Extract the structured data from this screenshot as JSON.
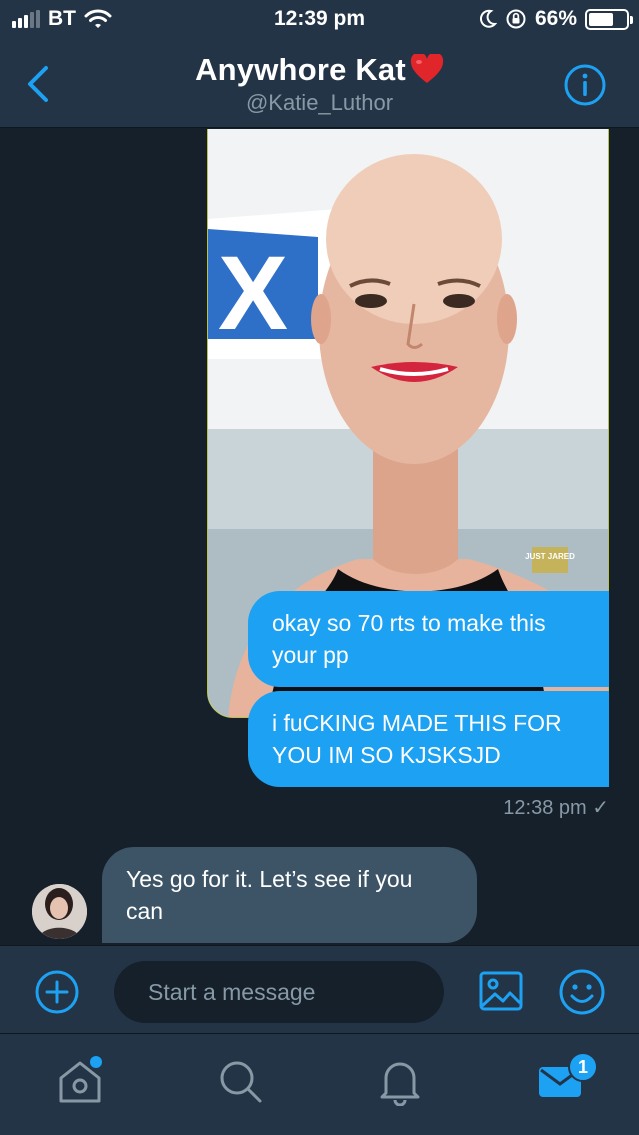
{
  "status_bar": {
    "carrier": "BT",
    "time": "12:39 pm",
    "battery_percent": "66%",
    "battery_level": 0.66
  },
  "header": {
    "title": "Anywhore Kat",
    "handle": "@Katie_Luthor",
    "title_emoji": "heart-icon"
  },
  "messages": [
    {
      "from": "me",
      "type": "image",
      "image_watermark": "JUST JARED"
    },
    {
      "from": "me",
      "text": "okay so 70 rts to make this your pp"
    },
    {
      "from": "me",
      "text": "i fuCKING MADE THIS FOR YOU IM SO KJSKSJD"
    },
    {
      "from": "them",
      "text": "Yes go for it. Let’s see if you can"
    }
  ],
  "sent_meta": {
    "time": "12:38 pm",
    "check": "✓"
  },
  "composer": {
    "placeholder": "Start a message"
  },
  "tabbar": {
    "messages_badge": "1"
  },
  "colors": {
    "background": "#15202b",
    "bar": "#243447",
    "accent": "#1da1f2",
    "incoming_bubble": "#3d5466",
    "muted_text": "#8899a6"
  }
}
